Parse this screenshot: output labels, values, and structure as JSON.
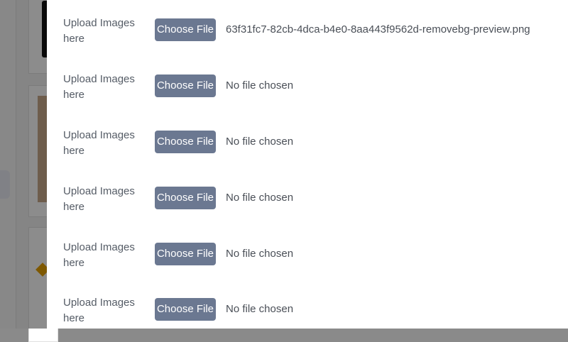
{
  "uploads": [
    {
      "label": "Upload Images here",
      "button": "Choose File",
      "status": "63f31fc7-82cb-4dca-b4e0-8aa443f9562d-removebg-preview.png"
    },
    {
      "label": "Upload Images here",
      "button": "Choose File",
      "status": "No file chosen"
    },
    {
      "label": "Upload Images here",
      "button": "Choose File",
      "status": "No file chosen"
    },
    {
      "label": "Upload Images here",
      "button": "Choose File",
      "status": "No file chosen"
    },
    {
      "label": "Upload Images here",
      "button": "Choose File",
      "status": "No file chosen"
    },
    {
      "label": "Upload Images here",
      "button": "Choose File",
      "status": "No file chosen"
    }
  ],
  "colors": {
    "button_bg": "#6b7891",
    "label_text": "#555c66",
    "overlay": "rgba(0,0,0,0.45)"
  }
}
